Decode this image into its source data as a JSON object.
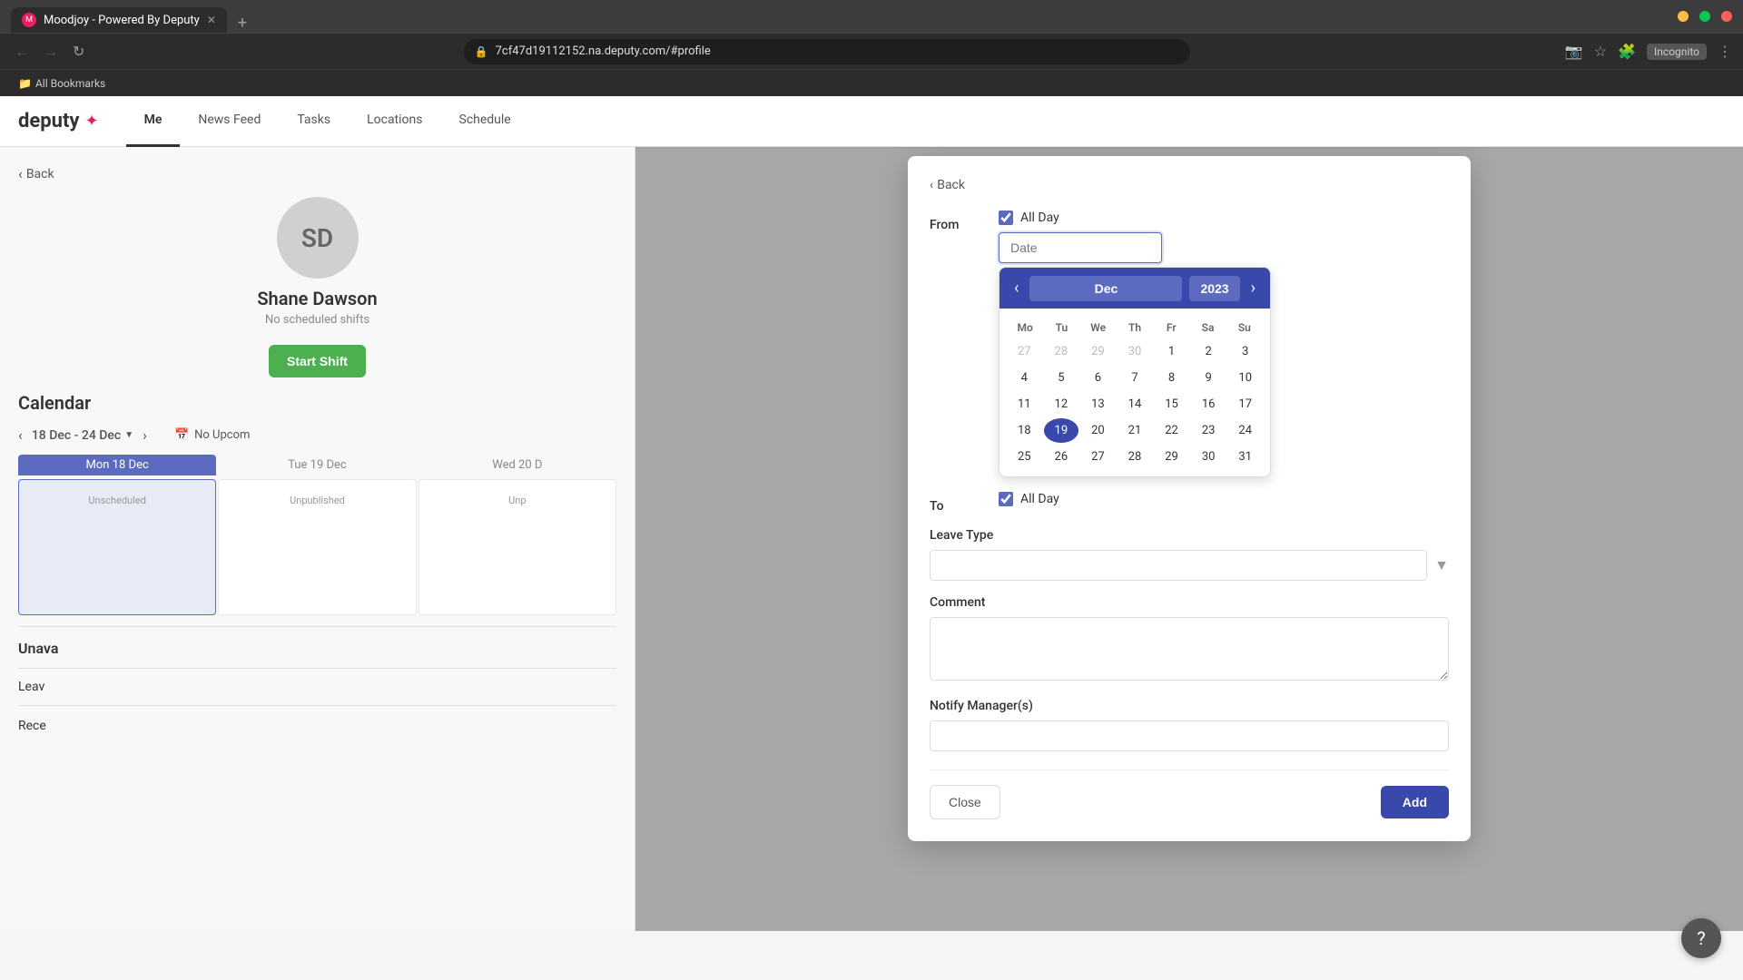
{
  "browser": {
    "url": "7cf47d19112152.na.deputy.com/#profile",
    "tab_title": "Moodjoy - Powered By Deputy",
    "incognito_label": "Incognito",
    "bookmarks_label": "All Bookmarks"
  },
  "nav": {
    "logo": "deputy",
    "tabs": [
      {
        "id": "me",
        "label": "Me",
        "active": true
      },
      {
        "id": "news-feed",
        "label": "News Feed",
        "active": false
      },
      {
        "id": "tasks",
        "label": "Tasks",
        "active": false
      },
      {
        "id": "locations",
        "label": "Locations",
        "active": false
      },
      {
        "id": "schedule",
        "label": "Schedule",
        "active": false
      }
    ]
  },
  "left_panel": {
    "back_label": "Back",
    "avatar_initials": "SD",
    "profile_name": "Shane Dawson",
    "profile_sub": "No scheduled shifts",
    "start_shift_label": "Start Shift",
    "calendar_title": "Calendar",
    "cal_range": "18 Dec - 24 Dec",
    "no_upcoming": "No Upcom",
    "days": [
      "Mon 18 Dec",
      "Tue 19 Dec",
      "Wed 20 D"
    ],
    "unavail_title": "Unava",
    "day_statuses": [
      "Unscheduled",
      "Unpublished",
      "Unp"
    ],
    "leave_label": "Leav",
    "recent_label": "Rece"
  },
  "modal": {
    "back_label": "Back",
    "from_label": "From",
    "to_label": "To",
    "all_day_label": "All Day",
    "date_placeholder": "Date",
    "leave_type_label": "Leave Type",
    "comment_label": "Comment",
    "notify_managers_label": "Notify Manager(s)",
    "close_label": "Close",
    "add_label": "Add"
  },
  "calendar_picker": {
    "month": "Dec",
    "year": "2023",
    "dow": [
      "Mo",
      "Tu",
      "We",
      "Th",
      "Fr",
      "Sa",
      "Su"
    ],
    "weeks": [
      [
        {
          "day": "27",
          "type": "other-month"
        },
        {
          "day": "28",
          "type": "other-month"
        },
        {
          "day": "29",
          "type": "other-month"
        },
        {
          "day": "30",
          "type": "other-month"
        },
        {
          "day": "1",
          "type": "normal"
        },
        {
          "day": "2",
          "type": "normal"
        },
        {
          "day": "3",
          "type": "normal"
        }
      ],
      [
        {
          "day": "4",
          "type": "normal"
        },
        {
          "day": "5",
          "type": "normal"
        },
        {
          "day": "6",
          "type": "normal"
        },
        {
          "day": "7",
          "type": "normal"
        },
        {
          "day": "8",
          "type": "normal"
        },
        {
          "day": "9",
          "type": "normal"
        },
        {
          "day": "10",
          "type": "normal"
        }
      ],
      [
        {
          "day": "11",
          "type": "normal"
        },
        {
          "day": "12",
          "type": "normal"
        },
        {
          "day": "13",
          "type": "normal"
        },
        {
          "day": "14",
          "type": "normal"
        },
        {
          "day": "15",
          "type": "normal"
        },
        {
          "day": "16",
          "type": "normal"
        },
        {
          "day": "17",
          "type": "normal"
        }
      ],
      [
        {
          "day": "18",
          "type": "normal"
        },
        {
          "day": "19",
          "type": "today"
        },
        {
          "day": "20",
          "type": "normal"
        },
        {
          "day": "21",
          "type": "normal"
        },
        {
          "day": "22",
          "type": "normal"
        },
        {
          "day": "23",
          "type": "normal"
        },
        {
          "day": "24",
          "type": "normal"
        }
      ],
      [
        {
          "day": "25",
          "type": "normal"
        },
        {
          "day": "26",
          "type": "normal"
        },
        {
          "day": "27",
          "type": "normal"
        },
        {
          "day": "28",
          "type": "normal"
        },
        {
          "day": "29",
          "type": "normal"
        },
        {
          "day": "30",
          "type": "normal"
        },
        {
          "day": "31",
          "type": "normal"
        }
      ]
    ]
  },
  "colors": {
    "accent": "#3949ab",
    "accent_light": "#5c6bc0",
    "green": "#4caf50",
    "today_bg": "#3949ab"
  }
}
